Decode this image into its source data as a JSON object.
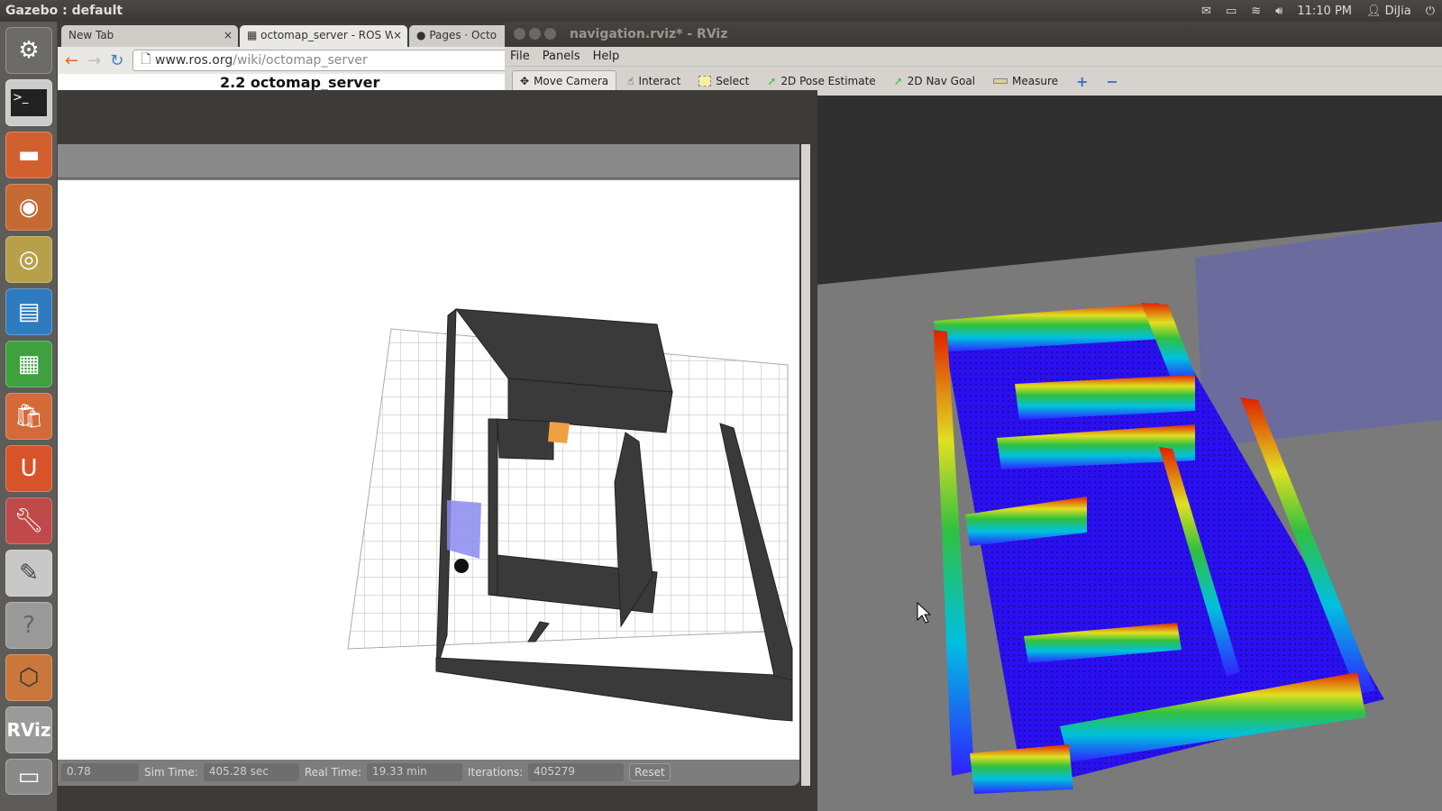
{
  "topbar": {
    "title": "Gazebo : default",
    "clock": "11:10 PM",
    "user": "DiJia",
    "icons": [
      "mail-icon",
      "battery-icon",
      "wifi-icon",
      "volume-icon",
      "user-icon",
      "power-icon"
    ]
  },
  "launcher": {
    "items": [
      "ubuntu-dash",
      "terminal",
      "files",
      "firefox",
      "chrome",
      "libreoffice-writer",
      "libreoffice-calc",
      "software-center",
      "ubuntu-one",
      "system-settings",
      "text-editor",
      "help",
      "gazebo",
      "rviz",
      "workspace-switcher"
    ],
    "rviz_label": "RViz"
  },
  "browser": {
    "tabs": [
      {
        "label": "New Tab"
      },
      {
        "label": "octomap_server - ROS Wi"
      },
      {
        "label": "Pages · Octo"
      }
    ],
    "url_host": "www.ros.org",
    "url_path": "/wiki/octomap_server",
    "page_heading": "2.2 octomap_server"
  },
  "gazebo": {
    "status": {
      "rtf": "0.78",
      "sim_time_label": "Sim Time:",
      "sim_time": "405.28 sec",
      "real_time_label": "Real Time:",
      "real_time": "19.33 min",
      "iterations_label": "Iterations:",
      "iterations": "405279",
      "reset_label": "Reset"
    }
  },
  "rviz": {
    "title": "navigation.rviz* - RViz",
    "menu": [
      "File",
      "Panels",
      "Help"
    ],
    "tools": [
      {
        "label": "Move Camera",
        "icon": "move-camera-icon"
      },
      {
        "label": "Interact",
        "icon": "hand-icon"
      },
      {
        "label": "Select",
        "icon": "select-icon"
      },
      {
        "label": "2D Pose Estimate",
        "icon": "green-arrow-icon"
      },
      {
        "label": "2D Nav Goal",
        "icon": "green-arrow-icon"
      },
      {
        "label": "Measure",
        "icon": "ruler-icon"
      }
    ],
    "colors": {
      "floor": "#2a10f0",
      "wall_top": "#e02000",
      "wall_mid": "#30c040",
      "background": "#303030",
      "ground": "#7a7a7a"
    }
  }
}
